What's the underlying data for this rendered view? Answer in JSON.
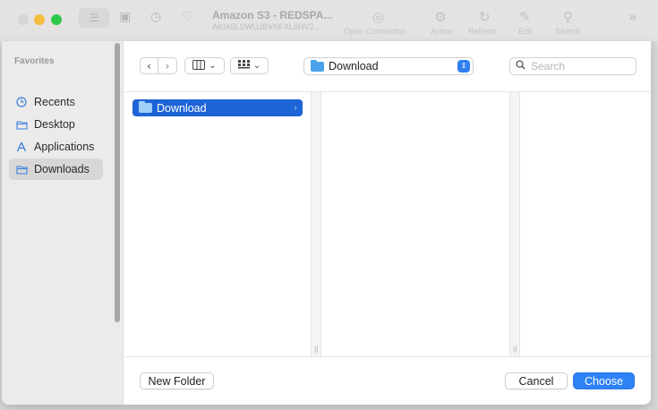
{
  "background_window": {
    "title": "Amazon S3 - REDSPA...",
    "subtitle": "AKIA5LSWUJBVNFXL6HV2...",
    "toolbar_items": [
      {
        "label": "Open Connection",
        "icon": "globe-plus-icon"
      },
      {
        "label": "Action",
        "icon": "gear-icon"
      },
      {
        "label": "Refresh",
        "icon": "refresh-icon"
      },
      {
        "label": "Edit",
        "icon": "pencil-icon"
      },
      {
        "label": "Search",
        "icon": "search-icon"
      }
    ]
  },
  "sidebar": {
    "heading": "Favorites",
    "items": [
      {
        "label": "Recents",
        "icon": "clock-icon",
        "selected": false
      },
      {
        "label": "Desktop",
        "icon": "folder-icon",
        "selected": false
      },
      {
        "label": "Applications",
        "icon": "applications-icon",
        "selected": false
      },
      {
        "label": "Downloads",
        "icon": "folder-icon",
        "selected": true
      }
    ]
  },
  "toolbar": {
    "path_popup_label": "Download",
    "search_placeholder": "Search"
  },
  "columns": {
    "first_column_items": [
      {
        "label": "Download",
        "selected": true
      }
    ]
  },
  "footer": {
    "new_folder_label": "New Folder",
    "cancel_label": "Cancel",
    "choose_label": "Choose"
  },
  "colors": {
    "accent": "#2e82f5",
    "selection": "#1d64d6",
    "sidebar_bg": "#ecebea"
  }
}
